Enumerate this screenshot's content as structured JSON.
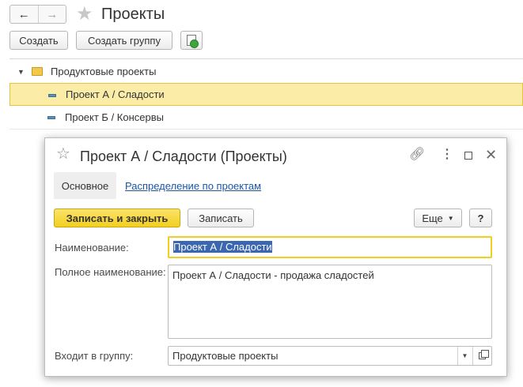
{
  "header": {
    "title": "Проекты",
    "back_icon": "arrow-left-icon",
    "forward_icon": "arrow-right-icon",
    "favorite_icon": "star-icon"
  },
  "toolbar": {
    "create_label": "Создать",
    "create_group_label": "Создать группу",
    "add_icon": "add-document-icon"
  },
  "tree": {
    "group": {
      "label": "Продуктовые проекты",
      "icon": "folder-icon"
    },
    "items": [
      {
        "label": "Проект А / Сладости",
        "selected": true
      },
      {
        "label": "Проект Б / Консервы",
        "selected": false
      }
    ]
  },
  "dialog": {
    "title": "Проект А / Сладости (Проекты)",
    "tabs": [
      {
        "label": "Основное",
        "active": true
      },
      {
        "label": "Распределение по проектам",
        "active": false
      }
    ],
    "buttons": {
      "save_close": "Записать и закрыть",
      "save": "Записать",
      "more": "Еще",
      "help": "?"
    },
    "fields": {
      "name_label": "Наименование:",
      "name_value": "Проект А / Сладости",
      "full_name_label": "Полное наименование:",
      "full_name_value": "Проект А / Сладости - продажа сладостей",
      "group_label": "Входит в группу:",
      "group_value": "Продуктовые проекты"
    }
  },
  "colors": {
    "accent_yellow": "#f2cf1f",
    "selection_bg": "#fbeda8",
    "link_blue": "#1a56a8"
  }
}
